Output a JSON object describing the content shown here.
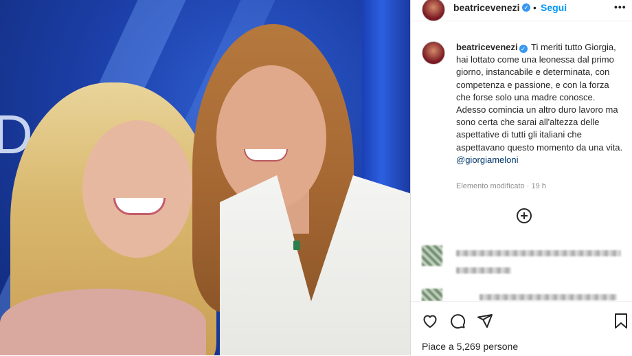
{
  "post": {
    "username": "beatricevenezi",
    "follow_label": "Segui",
    "dot": "•",
    "more": "•••",
    "caption_text": "Ti meriti tutto Giorgia, hai lottato come una leonessa dal primo giorno, instancabile e determinata, con competenza e passione, e con la forza che forse solo una madre conosce. Adesso comincia un altro duro lavoro ma sono certa che sarai all'altezza delle aspettative di tutti gli italiani che aspettavano questo momento da una vita.",
    "mention": "@giorgiameloni",
    "edited_label": "Elemento modificato",
    "separator": "·",
    "time_ago": "19 h",
    "likes_text": "Piace a 5,269 persone"
  },
  "icons": {
    "verified": "verified-badge-icon",
    "more": "more-options-icon",
    "add": "add-comment-icon",
    "like": "heart-icon",
    "comment": "comment-icon",
    "share": "share-icon",
    "save": "bookmark-icon"
  },
  "colors": {
    "accent": "#0095f6",
    "verified": "#3897f0",
    "mention": "#00376b",
    "meta": "#8e8e8e"
  }
}
